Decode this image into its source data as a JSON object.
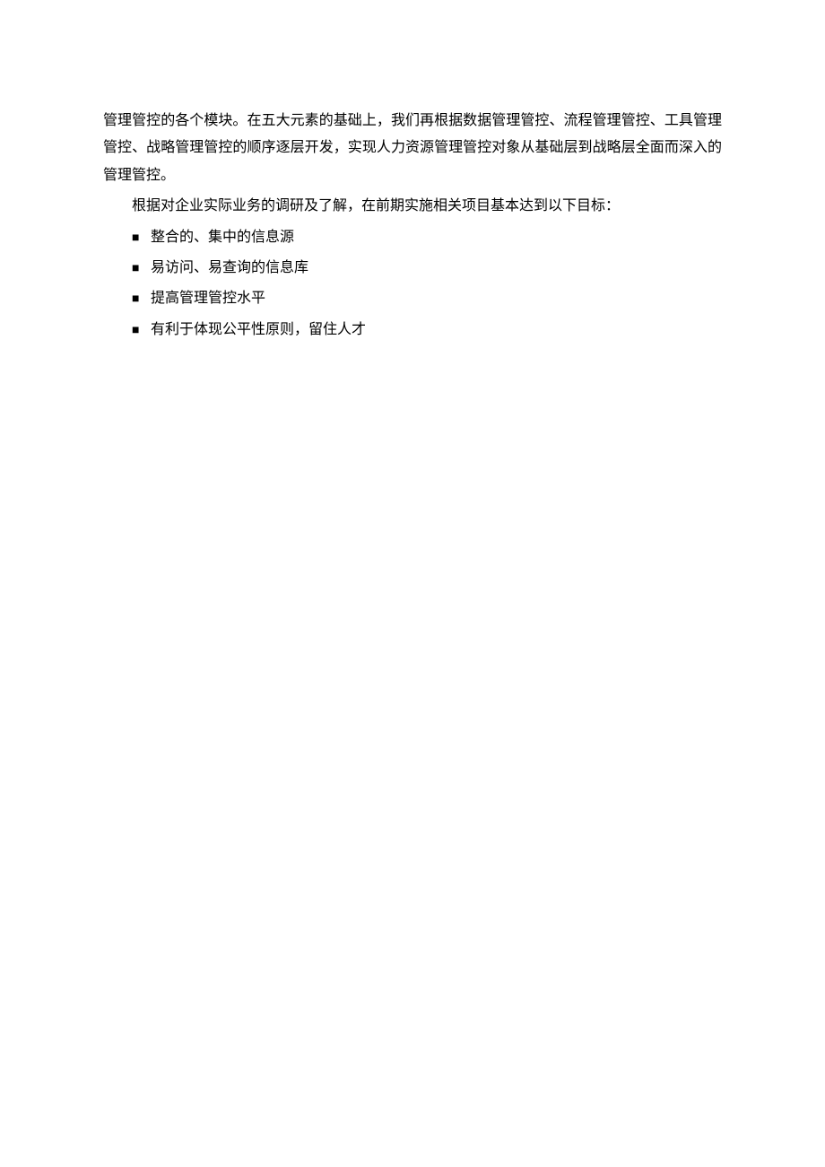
{
  "paragraphs": {
    "p1": "管理管控的各个模块。在五大元素的基础上，我们再根据数据管理管控、流程管理管控、工具管理管控、战略管理管控的顺序逐层开发，实现人力资源管理管控对象从基础层到战略层全面而深入的管理管控。",
    "p2": "根据对企业实际业务的调研及了解，在前期实施相关项目基本达到以下目标："
  },
  "bullets": [
    "整合的、集中的信息源",
    "易访问、易查询的信息库",
    "提高管理管控水平",
    "有利于体现公平性原则，留住人才"
  ],
  "bullet_marker": "■"
}
